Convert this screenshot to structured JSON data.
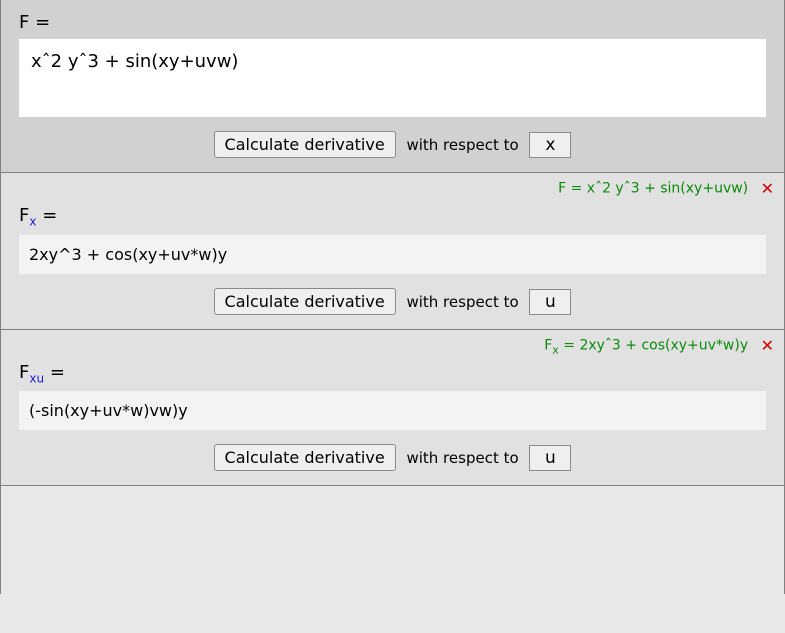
{
  "labels": {
    "calc_button": "Calculate derivative",
    "with_respect_to": "with respect to",
    "eq": "="
  },
  "main": {
    "symbol": "F",
    "expression": "xˆ2 yˆ3 + sin(xy+uvw)",
    "var": "x"
  },
  "steps": [
    {
      "corner_symbol": "F",
      "corner_sub": "",
      "corner_expr": "xˆ2 yˆ3 + sin(xy+uvw)",
      "label_symbol": "F",
      "label_sub": "x",
      "expression": "2xy^3 + cos(xy+uv*w)y",
      "var": "u"
    },
    {
      "corner_symbol": "F",
      "corner_sub": "x",
      "corner_expr": "2xyˆ3 + cos(xy+uv*w)y",
      "label_symbol": "F",
      "label_sub": "xu",
      "expression": "(-sin(xy+uv*w)vw)y",
      "var": "u"
    }
  ]
}
